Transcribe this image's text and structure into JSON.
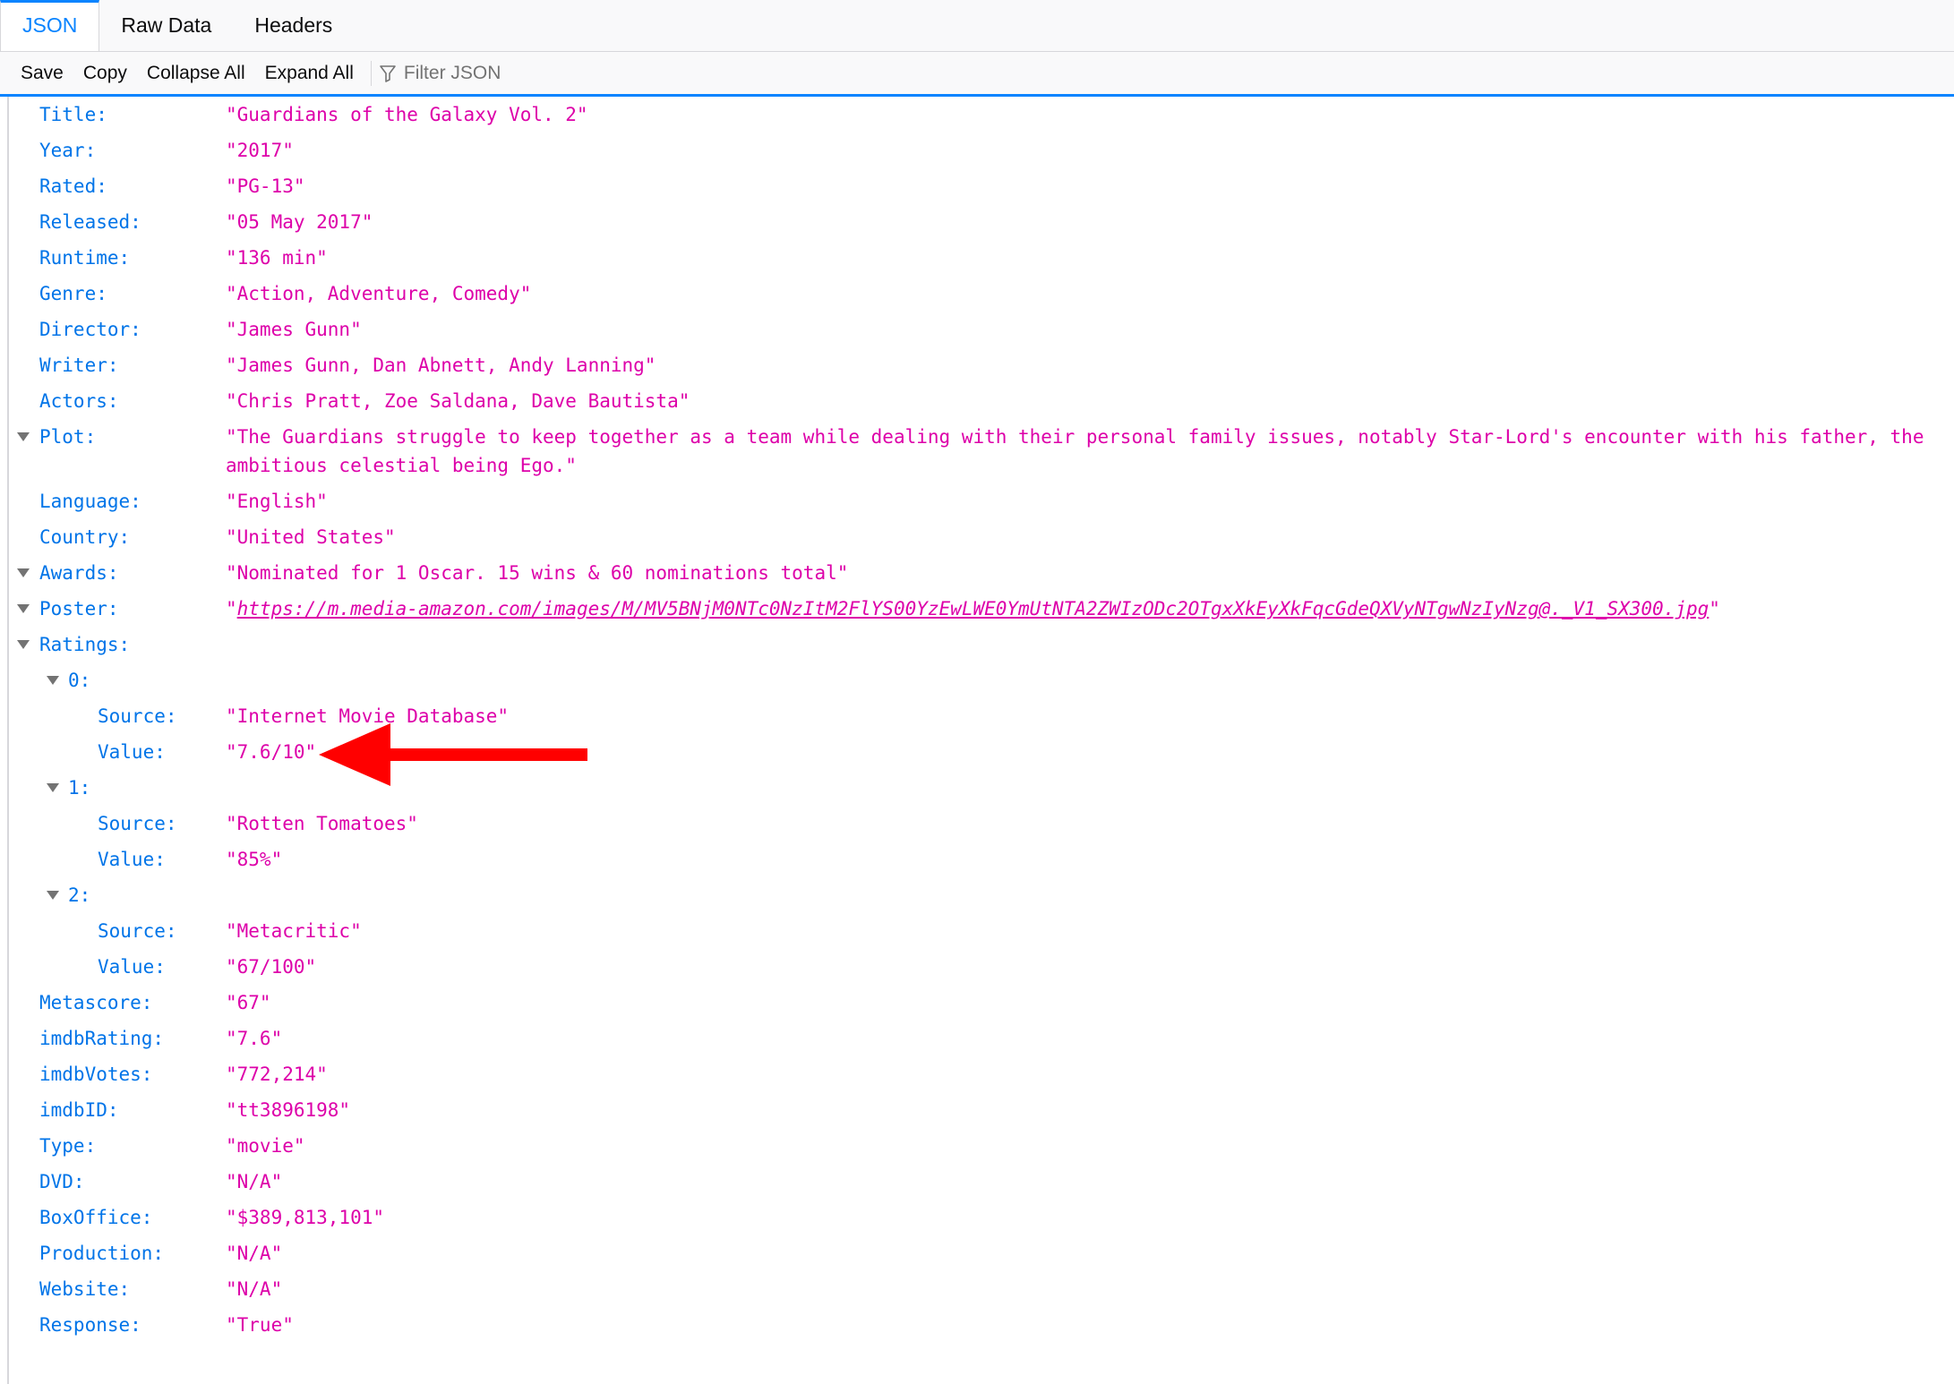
{
  "tabs": [
    {
      "label": "JSON",
      "active": true
    },
    {
      "label": "Raw Data",
      "active": false
    },
    {
      "label": "Headers",
      "active": false
    }
  ],
  "toolbar": {
    "save_label": "Save",
    "copy_label": "Copy",
    "collapse_label": "Collapse All",
    "expand_label": "Expand All",
    "filter_placeholder": "Filter JSON",
    "filter_icon": "funnel-icon"
  },
  "colors": {
    "accent": "#0a84ff",
    "key": "#0074e8",
    "string": "#dd00a9",
    "annotation_arrow": "#ff0000"
  },
  "json": {
    "Title": "\"Guardians of the Galaxy Vol. 2\"",
    "Year": "\"2017\"",
    "Rated": "\"PG-13\"",
    "Released": "\"05 May 2017\"",
    "Runtime": "\"136 min\"",
    "Genre": "\"Action, Adventure, Comedy\"",
    "Director": "\"James Gunn\"",
    "Writer": "\"James Gunn, Dan Abnett, Andy Lanning\"",
    "Actors": "\"Chris Pratt, Zoe Saldana, Dave Bautista\"",
    "Plot": "\"The Guardians struggle to keep together as a team while dealing with their personal family issues, notably Star-Lord's encounter with his father, the ambitious celestial being Ego.\"",
    "Language": "\"English\"",
    "Country": "\"United States\"",
    "Awards": "\"Nominated for 1 Oscar. 15 wins & 60 nominations total\"",
    "Poster_url": "https://m.media-amazon.com/images/M/MV5BNjM0NTc0NzItM2FlYS00YzEwLWE0YmUtNTA2ZWIzODc2OTgxXkEyXkFqcGdeQXVyNTgwNzIyNzg@._V1_SX300.jpg",
    "Ratings": [
      {
        "Source": "\"Internet Movie Database\"",
        "Value": "\"7.6/10\""
      },
      {
        "Source": "\"Rotten Tomatoes\"",
        "Value": "\"85%\""
      },
      {
        "Source": "\"Metacritic\"",
        "Value": "\"67/100\""
      }
    ],
    "Metascore": "\"67\"",
    "imdbRating": "\"7.6\"",
    "imdbVotes": "\"772,214\"",
    "imdbID": "\"tt3896198\"",
    "Type": "\"movie\"",
    "DVD": "\"N/A\"",
    "BoxOffice": "\"$389,813,101\"",
    "Production": "\"N/A\"",
    "Website": "\"N/A\"",
    "Response": "\"True\""
  },
  "labels": {
    "Title": "Title:",
    "Year": "Year:",
    "Rated": "Rated:",
    "Released": "Released:",
    "Runtime": "Runtime:",
    "Genre": "Genre:",
    "Director": "Director:",
    "Writer": "Writer:",
    "Actors": "Actors:",
    "Plot": "Plot:",
    "Language": "Language:",
    "Country": "Country:",
    "Awards": "Awards:",
    "Poster": "Poster:",
    "Ratings": "Ratings:",
    "idx0": "0:",
    "idx1": "1:",
    "idx2": "2:",
    "Source": "Source:",
    "Value": "Value:",
    "Metascore": "Metascore:",
    "imdbRating": "imdbRating:",
    "imdbVotes": "imdbVotes:",
    "imdbID": "imdbID:",
    "Type": "Type:",
    "DVD": "DVD:",
    "BoxOffice": "BoxOffice:",
    "Production": "Production:",
    "Website": "Website:",
    "Response": "Response:"
  },
  "quote": "\""
}
